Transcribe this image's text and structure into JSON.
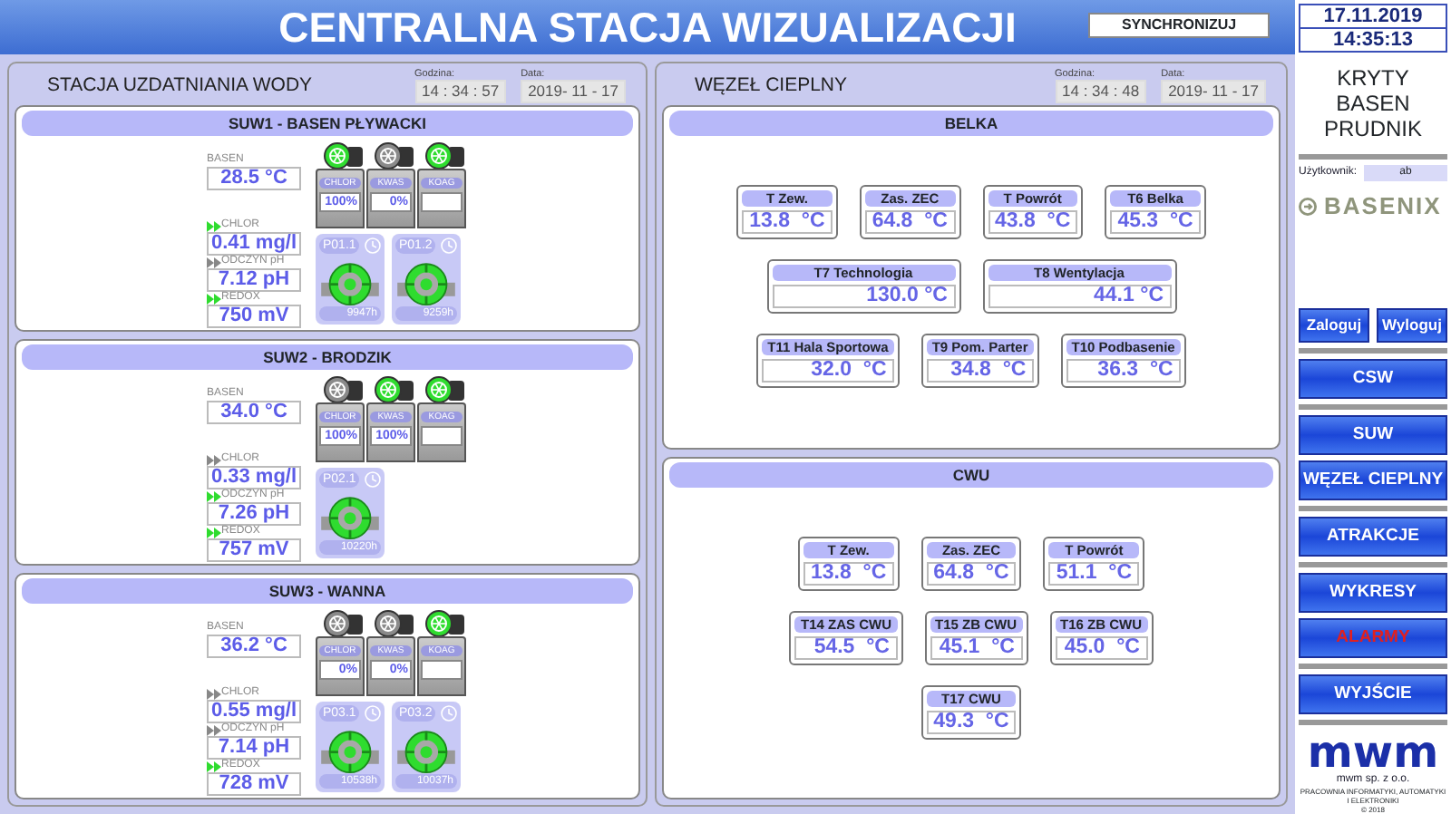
{
  "header": {
    "title": "CENTRALNA STACJA WIZUALIZACJI",
    "sync_button": "SYNCHRONIZUJ"
  },
  "water_panel": {
    "title": "STACJA UZDATNIANIA WODY",
    "time_label": "Godzina:",
    "time": "14 : 34 : 57",
    "date_label": "Data:",
    "date": "2019- 11 - 17",
    "stations": [
      {
        "title": "SUW1 - BASEN PŁYWACKI",
        "pool_label": "BASEN",
        "pool_value": "28.5 °C",
        "readings": [
          {
            "label": "CHLOR",
            "value": "0.41 mg/l",
            "active": true
          },
          {
            "label": "ODCZYN pH",
            "value": "7.12 pH",
            "active": false
          },
          {
            "label": "REDOX",
            "value": "750 mV",
            "active": true
          }
        ],
        "dosers": [
          {
            "label": "CHLOR",
            "value": "100%",
            "active": true
          },
          {
            "label": "KWAS",
            "value": "0%",
            "active": false
          },
          {
            "label": "KOAG",
            "active": true
          }
        ],
        "pumps": [
          {
            "label": "P01.1",
            "hours": "9947h"
          },
          {
            "label": "P01.2",
            "hours": "9259h"
          }
        ]
      },
      {
        "title": "SUW2 - BRODZIK",
        "pool_label": "BASEN",
        "pool_value": "34.0 °C",
        "readings": [
          {
            "label": "CHLOR",
            "value": "0.33 mg/l",
            "active": false
          },
          {
            "label": "ODCZYN pH",
            "value": "7.26 pH",
            "active": true
          },
          {
            "label": "REDOX",
            "value": "757 mV",
            "active": true
          }
        ],
        "dosers": [
          {
            "label": "CHLOR",
            "value": "100%",
            "active": false
          },
          {
            "label": "KWAS",
            "value": "100%",
            "active": true
          },
          {
            "label": "KOAG",
            "active": true
          }
        ],
        "pumps": [
          {
            "label": "P02.1",
            "hours": "10220h"
          }
        ]
      },
      {
        "title": "SUW3 - WANNA",
        "pool_label": "BASEN",
        "pool_value": "36.2 °C",
        "readings": [
          {
            "label": "CHLOR",
            "value": "0.55 mg/l",
            "active": false
          },
          {
            "label": "ODCZYN pH",
            "value": "7.14 pH",
            "active": false
          },
          {
            "label": "REDOX",
            "value": "728 mV",
            "active": true
          }
        ],
        "dosers": [
          {
            "label": "CHLOR",
            "value": "0%",
            "active": false
          },
          {
            "label": "KWAS",
            "value": "0%",
            "active": false
          },
          {
            "label": "KOAG",
            "active": true
          }
        ],
        "pumps": [
          {
            "label": "P03.1",
            "hours": "10538h"
          },
          {
            "label": "P03.2",
            "hours": "10037h"
          }
        ]
      }
    ]
  },
  "heat_panel": {
    "title": "WĘZEŁ CIEPLNY",
    "time_label": "Godzina:",
    "time": "14 : 34 : 48",
    "date_label": "Data:",
    "date": "2019- 11 - 17",
    "sections": [
      {
        "title": "BELKA",
        "rows": [
          {
            "sensors": [
              {
                "label": "T Zew.",
                "value": "13.8  °C"
              },
              {
                "label": "Zas. ZEC",
                "value": "64.8  °C"
              },
              {
                "label": "T Powrót",
                "value": "43.8  °C"
              },
              {
                "label": "T6 Belka",
                "value": "45.3  °C"
              }
            ]
          },
          {
            "sensors": [
              {
                "label": "T7 Technologia",
                "value": "130.0 °C"
              },
              {
                "label": "T8 Wentylacja",
                "value": "44.1 °C"
              }
            ]
          },
          {
            "sensors": [
              {
                "label": "T11 Hala Sportowa",
                "value": "32.0  °C"
              },
              {
                "label": "T9 Pom. Parter",
                "value": "34.8  °C"
              },
              {
                "label": "T10 Podbasenie",
                "value": "36.3  °C"
              }
            ]
          }
        ]
      },
      {
        "title": "CWU",
        "rows": [
          {
            "sensors": [
              {
                "label": "T Zew.",
                "value": "13.8  °C"
              },
              {
                "label": "Zas. ZEC",
                "value": "64.8  °C"
              },
              {
                "label": "T Powrót",
                "value": "51.1  °C"
              }
            ]
          },
          {
            "sensors": [
              {
                "label": "T14 ZAS CWU",
                "value": "54.5  °C"
              },
              {
                "label": "T15 ZB CWU",
                "value": "45.1  °C"
              },
              {
                "label": "T16 ZB CWU",
                "value": "45.0  °C"
              }
            ]
          },
          {
            "sensors": [
              {
                "label": "T17 CWU",
                "value": "49.3  °C"
              }
            ]
          }
        ]
      }
    ]
  },
  "sidebar": {
    "date": "17.11.2019",
    "time": "14:35:13",
    "site": "KRYTY BASEN PRUDNIK",
    "user_label": "Użytkownik:",
    "user": "ab",
    "brand": "BASENIX",
    "auth_buttons": [
      {
        "label": "Zaloguj"
      },
      {
        "label": "Wyloguj"
      }
    ],
    "nav_groups": [
      {
        "buttons": [
          {
            "label": "CSW",
            "kind": "nav"
          }
        ]
      },
      {
        "buttons": [
          {
            "label": "SUW",
            "kind": "nav"
          },
          {
            "label": "WĘZEŁ CIEPLNY",
            "kind": "nav"
          }
        ]
      },
      {
        "buttons": [
          {
            "label": "ATRAKCJE",
            "kind": "nav"
          }
        ]
      },
      {
        "buttons": [
          {
            "label": "WYKRESY",
            "kind": "nav"
          },
          {
            "label": "ALARMY",
            "kind": "alarm"
          }
        ]
      },
      {
        "buttons": [
          {
            "label": "WYJŚCIE",
            "kind": "nav"
          }
        ]
      }
    ],
    "company_logo": "mwm",
    "company": "mwm sp. z o.o.",
    "company_desc": "PRACOWNIA INFORMATYKI, AUTOMATYKI I ELEKTRONIKI",
    "copyright": "© 2018"
  }
}
